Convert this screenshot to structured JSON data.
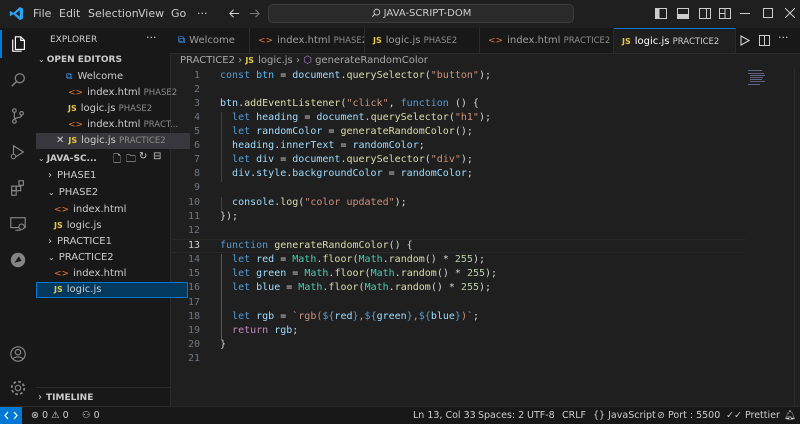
{
  "titlebar": {
    "menus": [
      "File",
      "Edit",
      "Selection",
      "View",
      "Go",
      "···"
    ],
    "search": "JAVA-SCRIPT-DOM"
  },
  "sidebar": {
    "explorer_title": "EXPLORER",
    "open_editors_title": "OPEN EDITORS",
    "open_editors": [
      {
        "name": "Welcome",
        "folder": ""
      },
      {
        "name": "index.html",
        "folder": "PHASE2"
      },
      {
        "name": "logic.js",
        "folder": "PHASE2"
      },
      {
        "name": "index.html",
        "folder": "PRACT..."
      },
      {
        "name": "logic.js",
        "folder": "PRACTICE2"
      }
    ],
    "workspace_title": "JAVA-SC...",
    "tree": [
      "PHASE1",
      "PHASE2",
      "index.html",
      "logic.js",
      "PRACTICE1",
      "PRACTICE2",
      "index.html",
      "logic.js"
    ],
    "timeline_title": "TIMELINE"
  },
  "tabs": [
    {
      "name": "Welcome",
      "folder": ""
    },
    {
      "name": "index.html",
      "folder": "PHASE2"
    },
    {
      "name": "logic.js",
      "folder": "PHASE2"
    },
    {
      "name": "index.html",
      "folder": "PRACTICE2"
    },
    {
      "name": "logic.js",
      "folder": "PRACTICE2"
    }
  ],
  "breadcrumb": {
    "folder": "PRACTICE2",
    "file": "logic.js",
    "symbol": "generateRandomColor"
  },
  "editor": {
    "line_numbers": [
      "1",
      "2",
      "3",
      "4",
      "5",
      "6",
      "7",
      "8",
      "9",
      "10",
      "11",
      "12",
      "13",
      "14",
      "15",
      "16",
      "17",
      "18",
      "19",
      "20",
      "21"
    ],
    "current_line": 13
  },
  "statusbar": {
    "errors": "0",
    "warnings": "0",
    "ports": "0",
    "position": "Ln 13, Col 33",
    "spaces": "Spaces: 2",
    "encoding": "UTF-8",
    "eol": "CRLF",
    "language": "JavaScript",
    "port": "Port : 5500",
    "formatter": "Prettier"
  },
  "colors": {
    "accent": "#0078d4",
    "background": "#1f1f1f",
    "sidebar": "#181818"
  }
}
